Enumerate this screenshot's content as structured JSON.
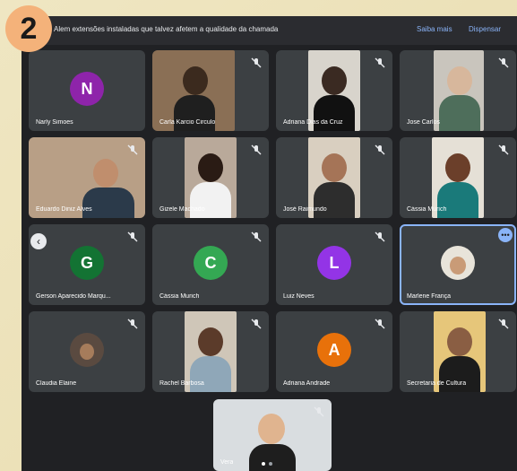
{
  "badge": "2",
  "banner": {
    "message": "Alem extensões instaladas que talvez afetem a qualidade da chamada",
    "learn_more": "Saiba mais",
    "dismiss": "Dispensar"
  },
  "participants": [
    {
      "name": "Narly Simoes",
      "initial": "N",
      "color": "#8e24aa"
    },
    {
      "name": "Carla Karcio Circulo"
    },
    {
      "name": "Adriana Dias da Cruz"
    },
    {
      "name": "Jose Carlos"
    },
    {
      "name": "Eduardo Diniz Alves"
    },
    {
      "name": "Gizele Machado"
    },
    {
      "name": "José Raimundo"
    },
    {
      "name": "Cássia Murich"
    },
    {
      "name": "Gerson Aparecido Marqu...",
      "initial": "G",
      "color": "#137333"
    },
    {
      "name": "Cássia Murich",
      "initial": "C",
      "color": "#34a853"
    },
    {
      "name": "Luiz Neves",
      "initial": "L",
      "color": "#9334e6"
    },
    {
      "name": "Marlene França"
    },
    {
      "name": "Claudia Elaine"
    },
    {
      "name": "Rachel Barbosa"
    },
    {
      "name": "Adriana Andrade",
      "initial": "A",
      "color": "#e8710a"
    },
    {
      "name": "Secretaria de Cultura"
    },
    {
      "name": "Vera"
    }
  ]
}
